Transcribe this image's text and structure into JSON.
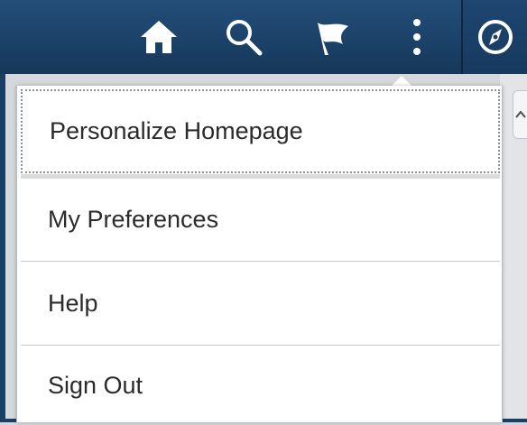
{
  "header": {
    "home_icon": "home-icon",
    "search_icon": "search-icon",
    "notifications_icon": "flag-icon",
    "actions_icon": "more-vertical-icon",
    "navbar_icon": "compass-icon"
  },
  "actions_menu": {
    "items": [
      {
        "label": "Personalize Homepage"
      },
      {
        "label": "My Preferences"
      },
      {
        "label": "Help"
      },
      {
        "label": "Sign Out"
      }
    ]
  },
  "colors": {
    "header_bg": "#1c4269",
    "menu_bg": "#ffffff",
    "text": "#2b2b2b"
  }
}
